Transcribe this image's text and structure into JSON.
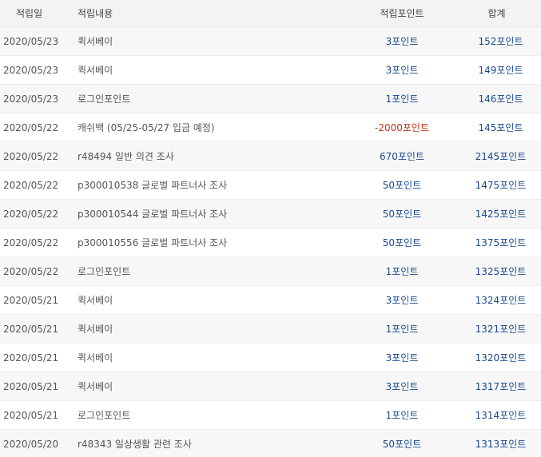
{
  "header": {
    "date": "적립일",
    "description": "적립내용",
    "points": "적립포인트",
    "total": "합계"
  },
  "rows": [
    {
      "date": "2020/05/23",
      "description": "퀵서베이",
      "points": "3포인트",
      "total": "152포인트",
      "negative": false
    },
    {
      "date": "2020/05/23",
      "description": "퀵서베이",
      "points": "3포인트",
      "total": "149포인트",
      "negative": false
    },
    {
      "date": "2020/05/23",
      "description": "로그인포인트",
      "points": "1포인트",
      "total": "146포인트",
      "negative": false
    },
    {
      "date": "2020/05/22",
      "description": "캐쉬백 (05/25-05/27 입금 예정)",
      "points": "-2000포인트",
      "total": "145포인트",
      "negative": true
    },
    {
      "date": "2020/05/22",
      "description": "r48494 일반 의견 조사",
      "points": "670포인트",
      "total": "2145포인트",
      "negative": false
    },
    {
      "date": "2020/05/22",
      "description": "p300010538 글로벌 파트너사 조사",
      "points": "50포인트",
      "total": "1475포인트",
      "negative": false
    },
    {
      "date": "2020/05/22",
      "description": "p300010544 글로벌 파트너사 조사",
      "points": "50포인트",
      "total": "1425포인트",
      "negative": false
    },
    {
      "date": "2020/05/22",
      "description": "p300010556 글로벌 파트너사 조사",
      "points": "50포인트",
      "total": "1375포인트",
      "negative": false
    },
    {
      "date": "2020/05/22",
      "description": "로그인포인트",
      "points": "1포인트",
      "total": "1325포인트",
      "negative": false
    },
    {
      "date": "2020/05/21",
      "description": "퀵서베이",
      "points": "3포인트",
      "total": "1324포인트",
      "negative": false
    },
    {
      "date": "2020/05/21",
      "description": "퀵서베이",
      "points": "1포인트",
      "total": "1321포인트",
      "negative": false
    },
    {
      "date": "2020/05/21",
      "description": "퀵서베이",
      "points": "3포인트",
      "total": "1320포인트",
      "negative": false
    },
    {
      "date": "2020/05/21",
      "description": "퀵서베이",
      "points": "3포인트",
      "total": "1317포인트",
      "negative": false
    },
    {
      "date": "2020/05/21",
      "description": "로그인포인트",
      "points": "1포인트",
      "total": "1314포인트",
      "negative": false
    },
    {
      "date": "2020/05/20",
      "description": "r48343 일상생활 관련 조사",
      "points": "50포인트",
      "total": "1313포인트",
      "negative": false
    }
  ],
  "colors": {
    "positive": "#1a4a8a",
    "negative": "#b5371c",
    "header_bg": "#f3f3f3",
    "alt_row_bg": "#f7f7f7"
  }
}
